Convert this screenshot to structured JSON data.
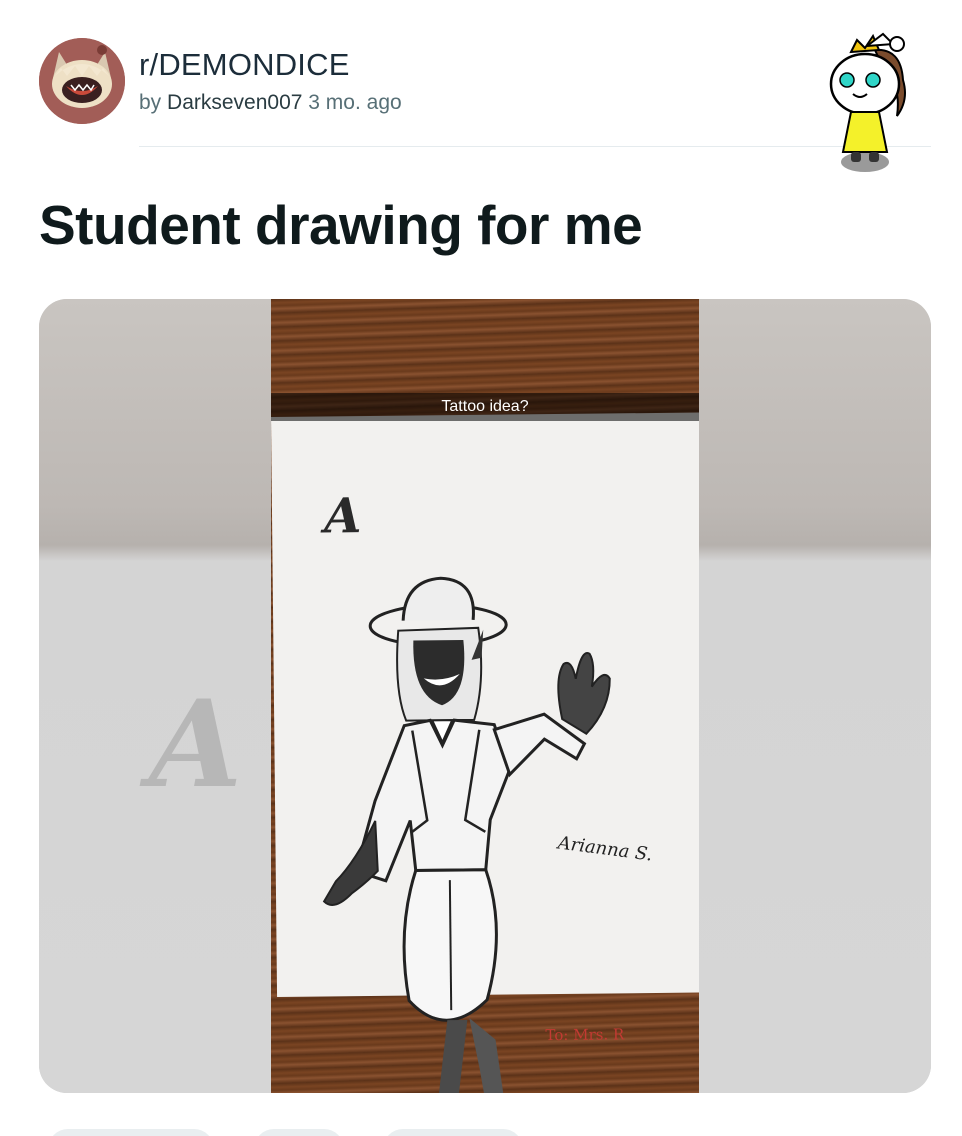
{
  "header": {
    "subreddit": "r/DEMONDICE",
    "by_prefix": "by",
    "author": "Darkseven007",
    "age": "3 mo. ago"
  },
  "post": {
    "title": "Student drawing for me"
  },
  "media": {
    "caption": "Tattoo idea?",
    "paper_letter": "A",
    "signature": "Arianna S.",
    "dedication": "To: Mrs. R"
  },
  "icons": {
    "subreddit_avatar": "demon-mascot-icon",
    "user_avatar": "snoo-avatar-icon"
  },
  "colors": {
    "title": "#0f1a1c",
    "meta": "#576f76",
    "wood": "#6a3a1c",
    "dedication_ink": "#c23a33"
  }
}
